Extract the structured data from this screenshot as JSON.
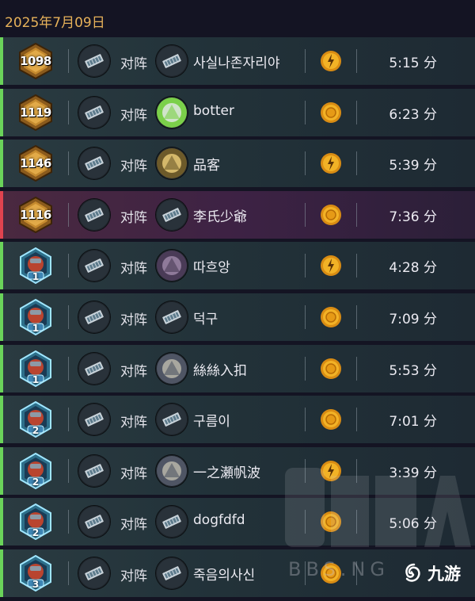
{
  "date_header": "2025年7月09日",
  "vs_label": "对阵",
  "colors": {
    "win": "#6ad35a",
    "loss": "#e0434f",
    "date": "#e7b25a"
  },
  "matches": [
    {
      "result": "win",
      "rank_type": "legend",
      "rank": "1098",
      "opponent": "사실나존자리야",
      "coin": "the-coin",
      "duration": "5:15 分",
      "opp_icon": "deck-icon"
    },
    {
      "result": "win",
      "rank_type": "legend",
      "rank": "1119",
      "opponent": "botter",
      "coin": "coin",
      "duration": "6:23 分",
      "opp_icon": "green-claw-icon"
    },
    {
      "result": "win",
      "rank_type": "legend",
      "rank": "1146",
      "opponent": "品客",
      "coin": "the-coin",
      "duration": "5:39 分",
      "opp_icon": "gold-warrior-icon"
    },
    {
      "result": "loss",
      "rank_type": "legend",
      "rank": "1116",
      "opponent": "李氏少爺",
      "coin": "coin",
      "duration": "7:36 分",
      "opp_icon": "deck-icon"
    },
    {
      "result": "win",
      "rank_type": "diamond",
      "rank": "1",
      "opponent": "따흐앙",
      "coin": "the-coin",
      "duration": "4:28 分",
      "opp_icon": "purple-creature-icon"
    },
    {
      "result": "win",
      "rank_type": "diamond",
      "rank": "1",
      "opponent": "덕구",
      "coin": "coin",
      "duration": "7:09 分",
      "opp_icon": "deck-icon"
    },
    {
      "result": "win",
      "rank_type": "diamond",
      "rank": "1",
      "opponent": "絲絲入扣",
      "coin": "coin",
      "duration": "5:53 分",
      "opp_icon": "mage-icon"
    },
    {
      "result": "win",
      "rank_type": "diamond",
      "rank": "2",
      "opponent": "구름이",
      "coin": "coin",
      "duration": "7:01 分",
      "opp_icon": "deck-icon"
    },
    {
      "result": "win",
      "rank_type": "diamond",
      "rank": "2",
      "opponent": "一之瀬帆波",
      "coin": "the-coin",
      "duration": "3:39 分",
      "opp_icon": "mage-icon"
    },
    {
      "result": "win",
      "rank_type": "diamond",
      "rank": "2",
      "opponent": "dogfdfd",
      "coin": "coin",
      "duration": "5:06 分",
      "opp_icon": "deck-icon"
    },
    {
      "result": "win",
      "rank_type": "diamond",
      "rank": "3",
      "opponent": "죽음의사신",
      "coin": "coin",
      "duration": "",
      "opp_icon": "deck-icon"
    }
  ],
  "watermark": "NGA",
  "watermark_sub": "BBS.NG",
  "brand": "九游"
}
